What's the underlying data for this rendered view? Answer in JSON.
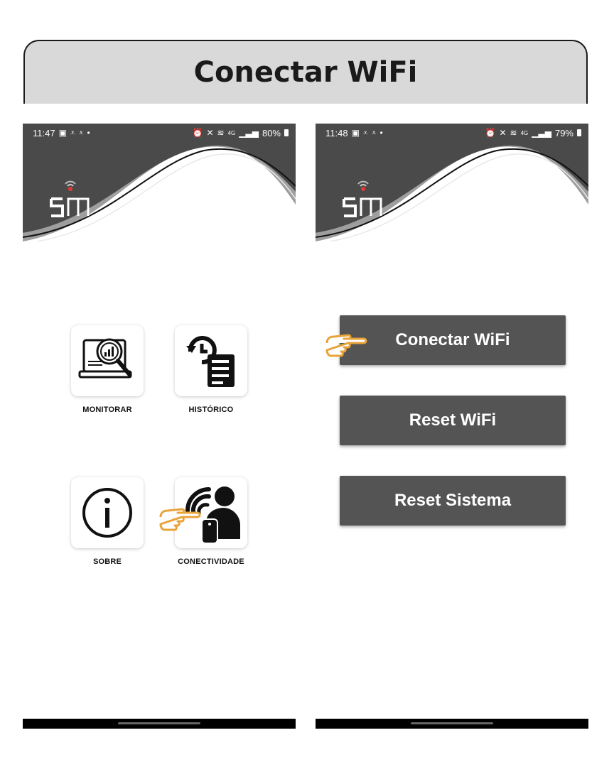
{
  "banner": {
    "title": "Conectar WiFi"
  },
  "left_phone": {
    "status": {
      "time": "11:47",
      "network": "4G",
      "battery": "80%"
    },
    "tiles": [
      {
        "label": "MONITORAR",
        "icon": "monitor-analytics-icon"
      },
      {
        "label": "HISTÓRICO",
        "icon": "history-document-icon"
      },
      {
        "label": "SOBRE",
        "icon": "info-icon"
      },
      {
        "label": "CONECTIVIDADE",
        "icon": "connectivity-person-icon"
      }
    ]
  },
  "right_phone": {
    "status": {
      "time": "11:48",
      "network": "4G",
      "battery": "79%"
    },
    "buttons": [
      {
        "label": "Conectar WiFi"
      },
      {
        "label": "Reset WiFi"
      },
      {
        "label": "Reset Sistema"
      }
    ]
  },
  "colors": {
    "header": "#4a4a4a",
    "button": "#545454",
    "pointer": "#e8a33a",
    "banner": "#d9d9d9"
  }
}
